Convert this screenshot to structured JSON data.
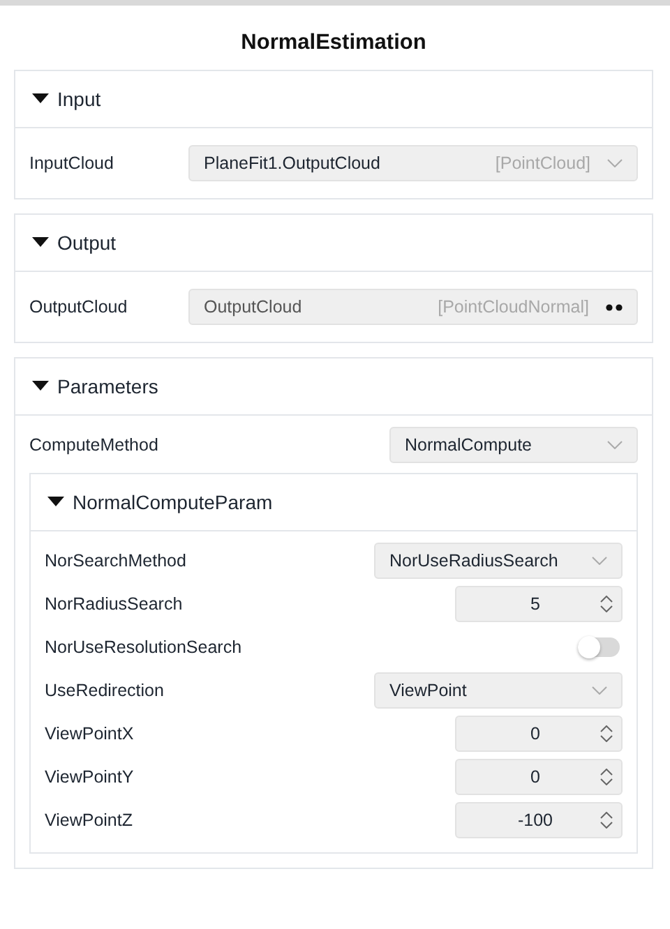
{
  "title": "NormalEstimation",
  "sections": [
    {
      "title": "Input",
      "expanded": true,
      "rows": [
        {
          "kind": "port_select",
          "label": "InputCloud",
          "value": "PlaneFit1.OutputCloud",
          "type": "[PointCloud]"
        }
      ]
    },
    {
      "title": "Output",
      "expanded": true,
      "rows": [
        {
          "kind": "port_output",
          "label": "OutputCloud",
          "value": "OutputCloud",
          "type": "[PointCloudNormal]"
        }
      ]
    },
    {
      "title": "Parameters",
      "expanded": true,
      "rows": [
        {
          "kind": "select",
          "label": "ComputeMethod",
          "value": "NormalCompute"
        },
        {
          "kind": "group",
          "title": "NormalComputeParam",
          "expanded": true,
          "rows": [
            {
              "kind": "select",
              "label": "NorSearchMethod",
              "value": "NorUseRadiusSearch"
            },
            {
              "kind": "number",
              "label": "NorRadiusSearch",
              "value": "5"
            },
            {
              "kind": "switch",
              "label": "NorUseResolutionSearch",
              "on": false
            },
            {
              "kind": "select",
              "label": "UseRedirection",
              "value": "ViewPoint"
            },
            {
              "kind": "number",
              "label": "ViewPointX",
              "value": "0"
            },
            {
              "kind": "number",
              "label": "ViewPointY",
              "value": "0"
            },
            {
              "kind": "number",
              "label": "ViewPointZ",
              "value": "-100"
            }
          ]
        }
      ]
    }
  ]
}
